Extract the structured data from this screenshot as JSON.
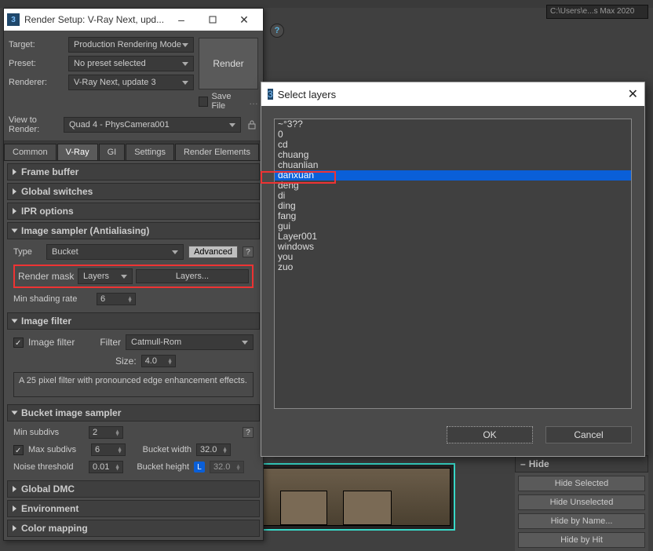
{
  "background": {
    "path_field": "C:\\Users\\e...s Max 2020"
  },
  "render_setup": {
    "title": "Render Setup: V-Ray Next, upd...",
    "target_label": "Target:",
    "target_value": "Production Rendering Mode",
    "preset_label": "Preset:",
    "preset_value": "No preset selected",
    "renderer_label": "Renderer:",
    "renderer_value": "V-Ray Next, update 3",
    "save_file_label": "Save File",
    "render_button": "Render",
    "view_to_label": "View to Render:",
    "view_to_value": "Quad 4 - PhysCamera001",
    "tabs": [
      "Common",
      "V-Ray",
      "GI",
      "Settings",
      "Render Elements"
    ],
    "active_tab_index": 1,
    "rollouts": {
      "frame_buffer": "Frame buffer",
      "global_switches": "Global switches",
      "ipr_options": "IPR options",
      "image_sampler": {
        "title": "Image sampler (Antialiasing)",
        "type_label": "Type",
        "type_value": "Bucket",
        "advanced_btn": "Advanced",
        "render_mask_label": "Render mask",
        "render_mask_value": "Layers",
        "layers_btn": "Layers...",
        "min_shading_label": "Min shading rate",
        "min_shading_value": "6"
      },
      "image_filter": {
        "title": "Image filter",
        "checkbox_label": "Image filter",
        "filter_label": "Filter",
        "filter_value": "Catmull-Rom",
        "size_label": "Size:",
        "size_value": "4.0",
        "description": "A 25 pixel filter with pronounced edge enhancement effects."
      },
      "bucket_sampler": {
        "title": "Bucket image sampler",
        "min_subdivs_label": "Min subdivs",
        "min_subdivs_value": "2",
        "max_subdivs_label": "Max subdivs",
        "max_subdivs_value": "6",
        "bucket_width_label": "Bucket width",
        "bucket_width_value": "32.0",
        "noise_threshold_label": "Noise threshold",
        "noise_threshold_value": "0.01",
        "bucket_height_label": "Bucket height",
        "bucket_height_value": "32.0"
      },
      "global_dmc": "Global DMC",
      "environment": "Environment",
      "color_mapping": "Color mapping"
    }
  },
  "select_layers": {
    "title": "Select layers",
    "items": [
      "~°3??",
      "0",
      "cd",
      "chuang",
      "chuanlian",
      "danxuan",
      "deng",
      "di",
      "ding",
      "fang",
      "gui",
      "Layer001",
      "windows",
      "you",
      "zuo"
    ],
    "selected_index": 5,
    "ok": "OK",
    "cancel": "Cancel"
  },
  "hide_panel": {
    "title": "Hide",
    "buttons": [
      "Hide Selected",
      "Hide Unselected",
      "Hide by Name...",
      "Hide by Hit"
    ]
  }
}
